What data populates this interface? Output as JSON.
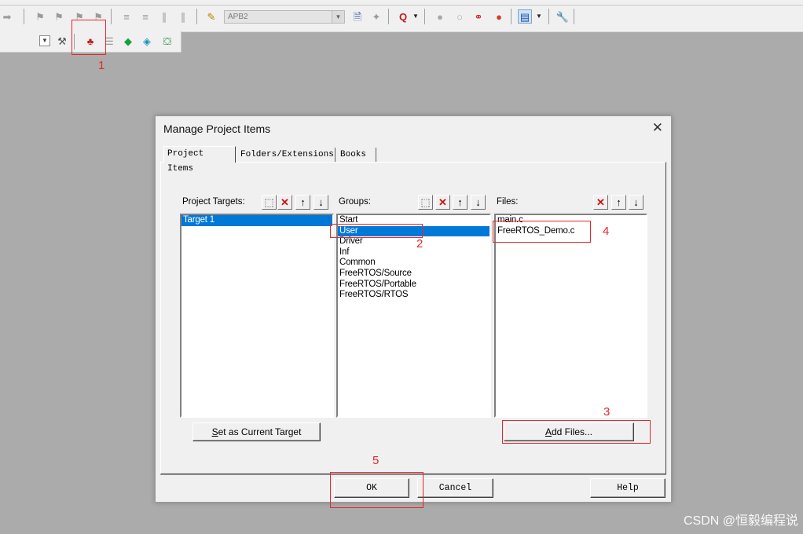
{
  "toolbar": {
    "combo_value": "APB2",
    "icons": [
      "arrow-right-icon",
      "bookmark-icon",
      "indent-icon",
      "unindent-icon",
      "comment-icon",
      "uncomment-icon",
      "open-file-icon",
      "find-icon",
      "debug-icon",
      "breakpoint-icon",
      "settings-icon",
      "manage-project-icon",
      "translate-icon",
      "build-icon",
      "rebuild-icon",
      "download-icon"
    ]
  },
  "annotations": {
    "n1": "1",
    "n2": "2",
    "n3": "3",
    "n4": "4",
    "n5": "5"
  },
  "dialog": {
    "title": "Manage Project Items",
    "close": "✕",
    "tabs": [
      {
        "label": "Project Items"
      },
      {
        "label": "Folders/Extensions"
      },
      {
        "label": "Books"
      }
    ],
    "targets": {
      "header": "Project Targets:",
      "items": [
        {
          "label": "Target 1",
          "selected": true
        }
      ]
    },
    "groups": {
      "header": "Groups:",
      "items": [
        {
          "label": "Start"
        },
        {
          "label": "User",
          "selected": true
        },
        {
          "label": "Driver"
        },
        {
          "label": "Inf"
        },
        {
          "label": "Common"
        },
        {
          "label": "FreeRTOS/Source"
        },
        {
          "label": "FreeRTOS/Portable"
        },
        {
          "label": "FreeRTOS/RTOS"
        }
      ]
    },
    "files": {
      "header": "Files:",
      "items": [
        {
          "label": "main.c"
        },
        {
          "label": "FreeRTOS_Demo.c"
        }
      ]
    },
    "buttons": {
      "set_target_first": "S",
      "set_target_rest": "et as Current Target",
      "add_first": "A",
      "add_rest": "dd Files...",
      "ok": "OK",
      "cancel": "Cancel",
      "help": "Help"
    }
  },
  "watermark": "CSDN @恒毅编程说"
}
